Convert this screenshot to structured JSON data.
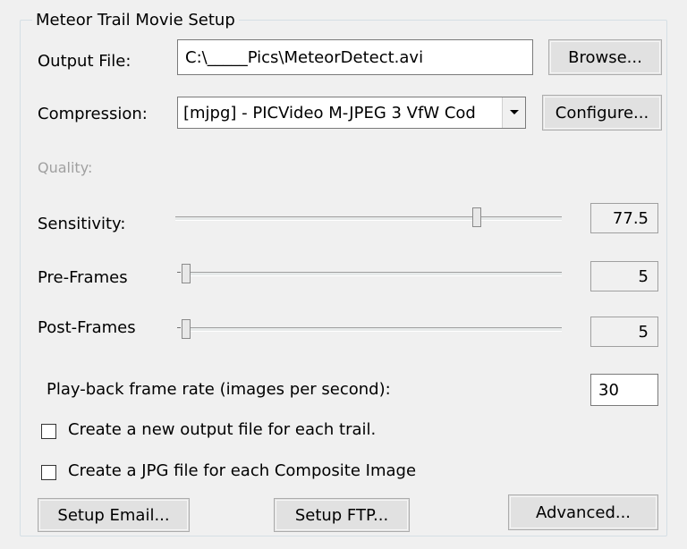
{
  "group": {
    "title": "Meteor Trail Movie Setup"
  },
  "output_file": {
    "label": "Output File:",
    "value": "C:\\_____Pics\\MeteorDetect.avi",
    "browse_label": "Browse..."
  },
  "compression": {
    "label": "Compression:",
    "selected": "[mjpg] - PICVideo M-JPEG 3 VfW Cod",
    "configure_label": "Configure..."
  },
  "quality": {
    "label": "Quality:"
  },
  "sensitivity": {
    "label": "Sensitivity:",
    "value": "77.5",
    "slider_fraction": 0.78
  },
  "pre_frames": {
    "label": "Pre-Frames",
    "value": "5",
    "slider_fraction": 0.0
  },
  "post_frames": {
    "label": "Post-Frames",
    "value": "5",
    "slider_fraction": 0.0
  },
  "playback": {
    "label": "Play-back frame rate (images per second):",
    "value": "30"
  },
  "checkbox_each_trail": {
    "label": "Create a new output file for each trail.",
    "checked": false
  },
  "checkbox_jpg": {
    "label": "Create a JPG file for each Composite Image",
    "checked": false
  },
  "buttons": {
    "setup_email": "Setup Email...",
    "setup_ftp": "Setup FTP...",
    "advanced": "Advanced..."
  }
}
